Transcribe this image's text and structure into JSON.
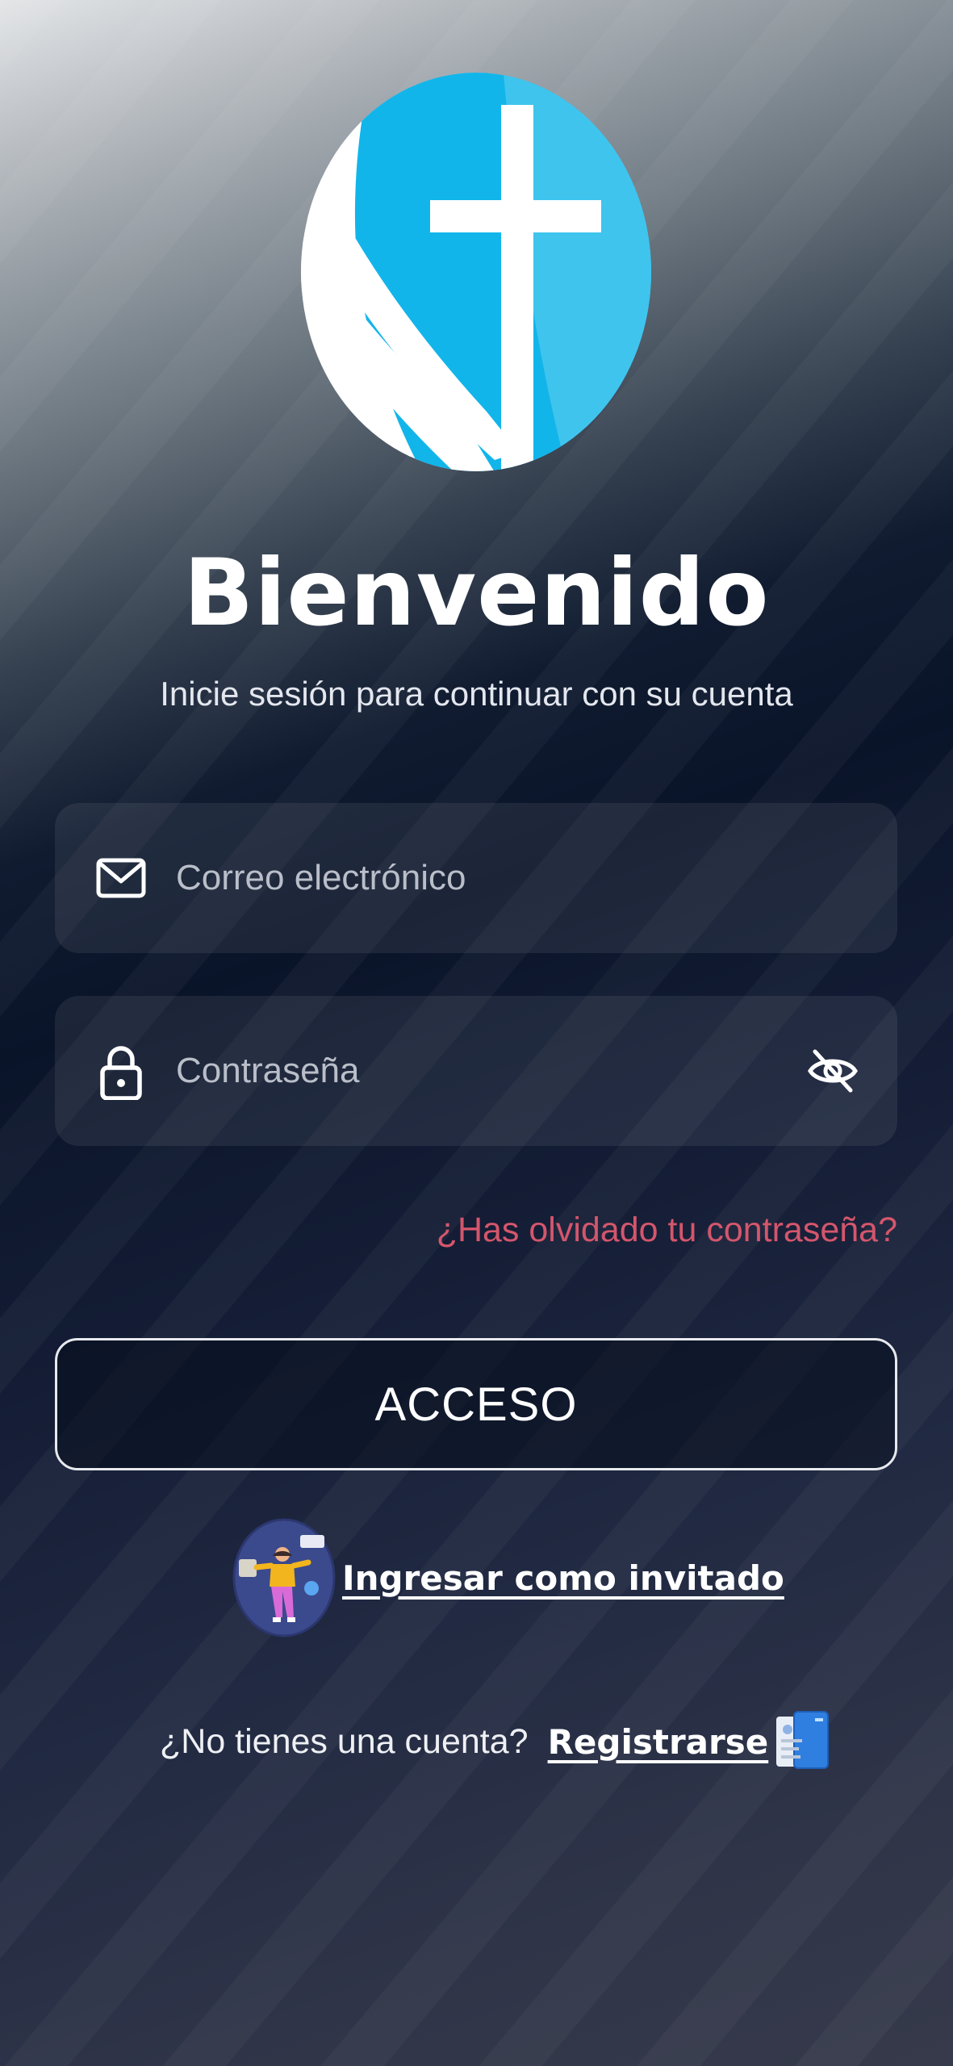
{
  "header": {
    "title": "Bienvenido",
    "subtitle": "Inicie sesión para continuar con su cuenta"
  },
  "icons": {
    "logo": "cross-logo-icon",
    "email": "mail-icon",
    "password": "lock-icon",
    "visibility": "eye-off-icon",
    "guest": "guest-avatar-icon",
    "register": "document-icon"
  },
  "form": {
    "email": {
      "value": "",
      "placeholder": "Correo electrónico"
    },
    "password": {
      "value": "",
      "placeholder": "Contraseña"
    },
    "forgot_label": "¿Has olvidado tu contraseña?",
    "submit_label": "ACCESO"
  },
  "guest": {
    "label": "Ingresar como invitado"
  },
  "signup": {
    "prompt": "¿No tienes una cuenta?",
    "link_label": "Registrarse"
  },
  "colors": {
    "accent": "#12b5ea",
    "forgot_link": "#d4566c",
    "field_bg": "rgba(255,255,255,0.075)",
    "text": "#ffffff"
  }
}
